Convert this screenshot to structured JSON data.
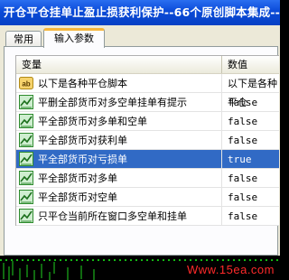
{
  "window": {
    "title": "开仓平仓挂单止盈止损获利保护--66个原创脚本集成--"
  },
  "tabs": [
    {
      "label": "常用",
      "active": false
    },
    {
      "label": "输入参数",
      "active": true
    }
  ],
  "table": {
    "headers": {
      "variable": "变量",
      "value": "数值"
    },
    "rows": [
      {
        "icon": "ab-string-icon",
        "label": "以下是各种平仓脚本",
        "value": "以下是各种平仓",
        "selected": false
      },
      {
        "icon": "bool-chart-icon",
        "label": "平删全部货币对多空单挂单有提示",
        "value": "false",
        "selected": false
      },
      {
        "icon": "bool-chart-icon",
        "label": "平全部货币对多单和空单",
        "value": "false",
        "selected": false
      },
      {
        "icon": "bool-chart-icon",
        "label": "平全部货币对获利单",
        "value": "false",
        "selected": false
      },
      {
        "icon": "bool-chart-icon",
        "label": "平全部货币对亏损单",
        "value": "true",
        "selected": true
      },
      {
        "icon": "bool-chart-icon",
        "label": "平全部货币对多单",
        "value": "false",
        "selected": false
      },
      {
        "icon": "bool-chart-icon",
        "label": "平全部货币对空单",
        "value": "false",
        "selected": false
      },
      {
        "icon": "bool-chart-icon",
        "label": "只平仓当前所在窗口多空单和挂单",
        "value": "false",
        "selected": false
      }
    ]
  },
  "watermark": "Www.15ea.com",
  "colors": {
    "selection": "#316ac5",
    "title_bar": "#0a4ad8",
    "tab_highlight": "#f7b63b",
    "watermark": "#ff2a2a"
  }
}
